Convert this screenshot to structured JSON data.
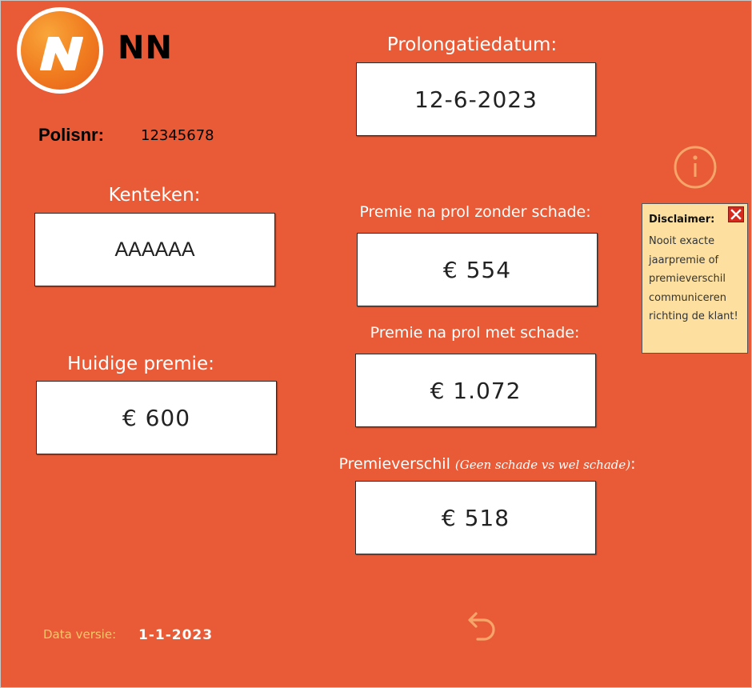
{
  "brand": {
    "name": "NN"
  },
  "policy": {
    "label": "Polisnr:",
    "value": "12345678"
  },
  "license": {
    "label": "Kenteken:",
    "value": "AAAAAA"
  },
  "current_premium": {
    "label": "Huidige premie:",
    "value": "€ 600"
  },
  "renewal_date": {
    "label": "Prolongatiedatum:",
    "value": "12-6-2023"
  },
  "premium_no_damage": {
    "label": "Premie na prol zonder schade:",
    "value": "€ 554"
  },
  "premium_with_damage": {
    "label": "Premie na prol met schade:",
    "value": "€ 1.072"
  },
  "premium_difference": {
    "label": "Premieverschil ",
    "label_note": "(Geen schade vs wel schade)",
    "label_suffix": ":",
    "value": "€ 518"
  },
  "disclaimer": {
    "title": "Disclaimer:",
    "text": "Nooit exacte jaarpremie of premieverschil communiceren richting de klant!"
  },
  "footer": {
    "version_label": "Data versie:",
    "version_value": "1-1-2023"
  },
  "icons": {
    "info": "info-circle-icon",
    "close": "close-x-icon",
    "undo": "undo-arrow-icon",
    "logo": "nn-logo-icon"
  },
  "colors": {
    "background": "#e85b36",
    "box": "#ffffff",
    "disclaimer_bg": "#fde09f",
    "accent_icon": "#f6a56a",
    "version_label": "#f7c66a",
    "close": "#d52b1e"
  }
}
